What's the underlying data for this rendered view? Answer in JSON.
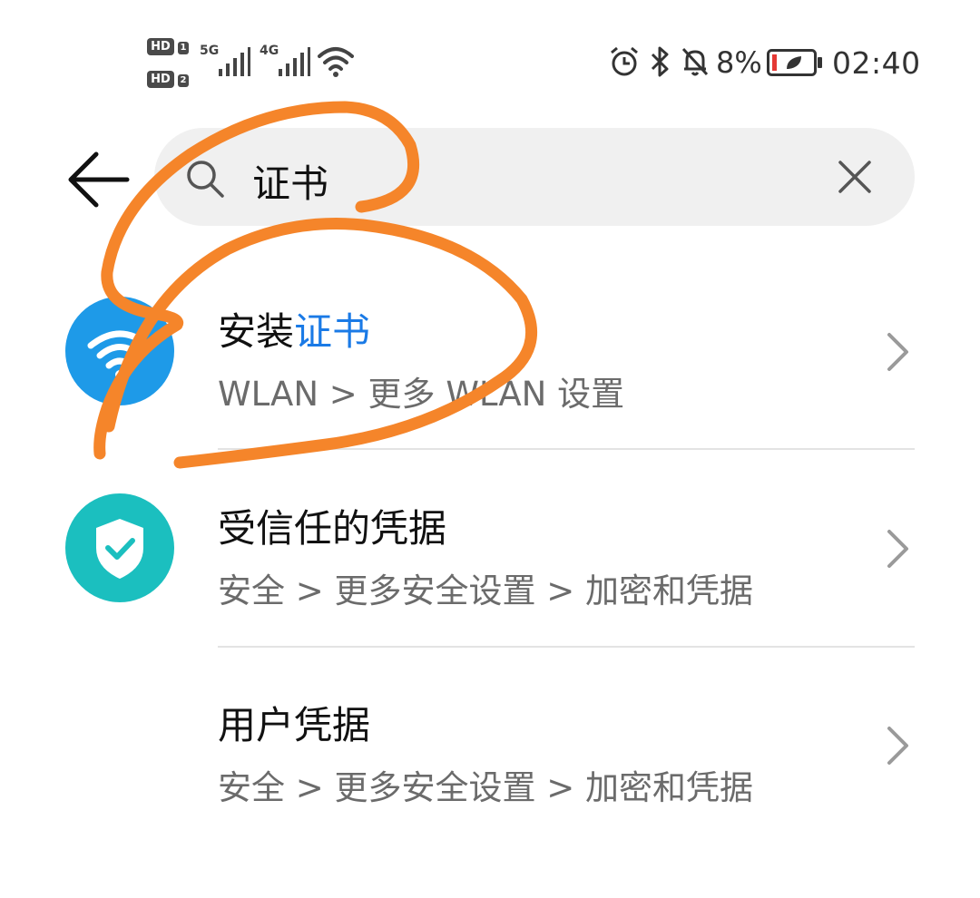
{
  "status_bar": {
    "hd1": "HD",
    "hd1_sim": "1",
    "hd2": "HD",
    "hd2_sim": "2",
    "net1": "5G",
    "net2": "4G",
    "battery_percent": "8%",
    "time": "02:40",
    "icons": [
      "alarm-icon",
      "bluetooth-icon",
      "mute-bell-icon",
      "battery-saver-icon",
      "wifi-icon"
    ]
  },
  "search": {
    "query": "证书",
    "back_icon": "arrow-left-icon",
    "search_icon": "magnifier-icon",
    "clear_icon": "close-icon"
  },
  "results": [
    {
      "title_plain": "安装",
      "title_highlight": "证书",
      "path": "WLAN > 更多 WLAN 设置",
      "icon": "wifi-icon",
      "icon_color": "#1e9ae8"
    },
    {
      "title_plain": "受信任的凭据",
      "title_highlight": "",
      "path": "安全 > 更多安全设置 > 加密和凭据",
      "icon": "shield-check-icon",
      "icon_color": "#1bbfbf"
    },
    {
      "title_plain": "用户凭据",
      "title_highlight": "",
      "path": "安全 > 更多安全设置 > 加密和凭据",
      "icon": "",
      "icon_color": ""
    }
  ],
  "colors": {
    "highlight": "#1a7ae6",
    "scribble": "#f5852a"
  }
}
